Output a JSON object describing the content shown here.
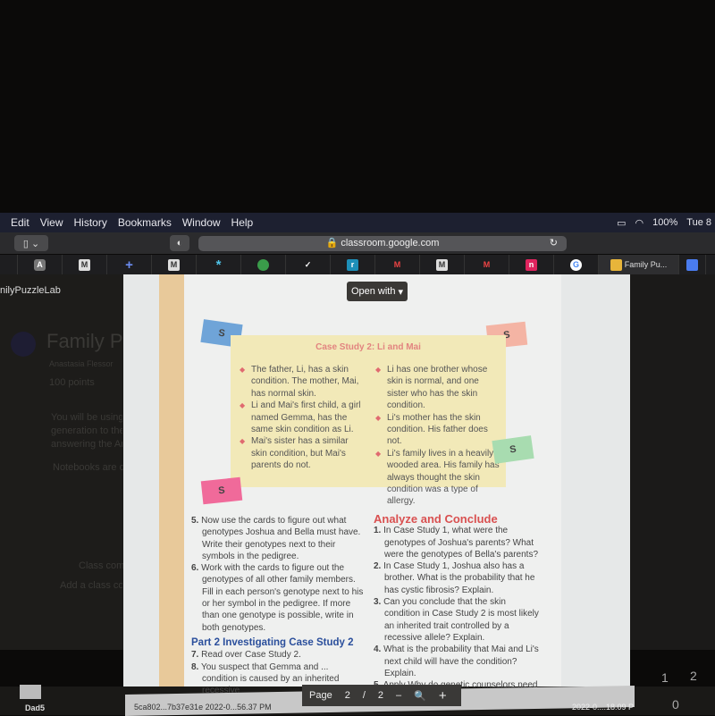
{
  "menubar": {
    "items": [
      "Edit",
      "View",
      "History",
      "Bookmarks",
      "Window",
      "Help"
    ],
    "battery": "100%",
    "day": "Tue 8"
  },
  "browser": {
    "url": "classroom.google.com",
    "tabs": [
      {
        "icon": "A"
      },
      {
        "icon": "M"
      },
      {
        "icon": "+"
      },
      {
        "icon": "M"
      },
      {
        "icon": "*"
      },
      {
        "icon": "leaf"
      },
      {
        "icon": "check"
      },
      {
        "icon": "r"
      },
      {
        "icon": "M"
      },
      {
        "icon": "M"
      },
      {
        "icon": "M"
      },
      {
        "icon": "n"
      },
      {
        "icon": "G"
      },
      {
        "label": "Family Pu..."
      },
      {
        "icon": "docs"
      }
    ]
  },
  "classroom": {
    "title_partial": "nilyPuzzleLab",
    "assignment": "Family P",
    "teacher": "Anastasia Flessor",
    "points": "100 points",
    "desc": [
      "You will be using t",
      "generation to the t",
      "answering the Ana"
    ],
    "notebooks": "Notebooks are du",
    "class_comments": "Class comm",
    "add_comment": "Add a class comm"
  },
  "viewer": {
    "open_with": "Open with",
    "page_label": "Page",
    "page": "2",
    "sep": "/",
    "total": "2",
    "minus": "–",
    "plus": "+"
  },
  "doc": {
    "card_label": "S",
    "case_title": "Case Study 2: Li and Mai",
    "left_bullets": [
      "The father, Li, has a skin condition. The mother, Mai, has normal skin.",
      "Li and Mai's first child, a girl named Gemma, has the same skin condition as Li.",
      "Mai's sister has a similar skin condition, but Mai's parents do not."
    ],
    "right_bullets": [
      "Li has one brother whose skin is normal, and one sister who has the skin condition.",
      "Li's mother has the skin condition. His father does not.",
      "Li's family lives in a heavily wooded area. His family has always thought the skin condition was a type of allergy."
    ],
    "steps": [
      {
        "n": "5.",
        "t": "Now use the cards to figure out what genotypes Joshua and Bella must have. Write their genotypes next to their symbols in the pedigree."
      },
      {
        "n": "6.",
        "t": "Work with the cards to figure out the genotypes of all other family members. Fill in each person's genotype next to his or her symbol in the pedigree. If more than one genotype is possible, write in both genotypes."
      }
    ],
    "part2": "Part 2  Investigating Case Study 2",
    "steps2": [
      {
        "n": "7.",
        "t": "Read over Case Study 2."
      },
      {
        "n": "8.",
        "t": "You suspect that Gemma and ... condition is caused by an inherited recessive"
      }
    ],
    "analyze_title": "Analyze and Conclude",
    "questions": [
      {
        "n": "1.",
        "t": "In Case Study 1, what were the genotypes of Joshua's parents? What were the genotypes of Bella's parents?"
      },
      {
        "n": "2.",
        "t": "In Case Study 1, Joshua also has a brother. What is the probability that he has cystic fibrosis? Explain."
      },
      {
        "n": "3.",
        "t": "Can you conclude that the skin condition in Case Study 2 is most likely an inherited trait controlled by a recessive allele? Explain."
      },
      {
        "n": "4.",
        "t": "What is the probability that Mai and Li's next child will have the condition? Explain."
      },
      {
        "n": "5.",
        "t": "Apply Why do genetic counselors need"
      }
    ]
  },
  "desktop": {
    "folder": "Dad5",
    "file1": "5ca802...7b37e31e  2022-0...56.37 PM",
    "file2": "2022-0....18.09 P",
    "keys": [
      "1",
      "2",
      "0"
    ]
  }
}
